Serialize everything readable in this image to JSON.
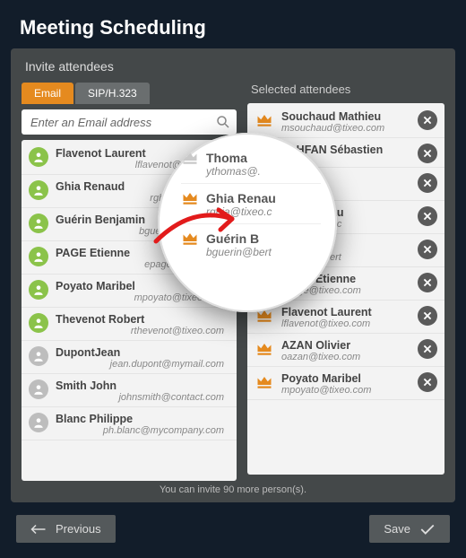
{
  "title": "Meeting Scheduling",
  "panelTitle": "Invite attendees",
  "tabs": {
    "email": "Email",
    "sip": "SIP/H.323"
  },
  "search": {
    "placeholder": "Enter an Email address"
  },
  "selectedTitle": "Selected attendees",
  "note": "You can invite 90 more person(s).",
  "footer": {
    "prev": "Previous",
    "save": "Save"
  },
  "contacts": [
    {
      "name": "Flavenot Laurent",
      "email": "lflavenot@tixeo.com",
      "status": "green"
    },
    {
      "name": "Ghia Renaud",
      "email": "rghia@tixeo.com",
      "status": "green"
    },
    {
      "name": "Guérin Benjamin",
      "email": "bguerin@tixeo.com",
      "status": "green"
    },
    {
      "name": "PAGE Etienne",
      "email": "epage@tixeo.com",
      "status": "green"
    },
    {
      "name": "Poyato Maribel",
      "email": "mpoyato@tixeo.com",
      "status": "green"
    },
    {
      "name": "Thevenot Robert",
      "email": "rthevenot@tixeo.com",
      "status": "green"
    },
    {
      "name": "DupontJean",
      "email": "jean.dupont@mymail.com",
      "status": "gray"
    },
    {
      "name": "Smith John",
      "email": "johnsmith@contact.com",
      "status": "gray"
    },
    {
      "name": "Blanc Philippe",
      "email": "ph.blanc@mycompany.com",
      "status": "gray"
    }
  ],
  "selected": [
    {
      "name": "Souchaud Mathieu",
      "email": "msouchaud@tixeo.com"
    },
    {
      "name": "LAHFAN Sébastien",
      "email": ""
    },
    {
      "name": "Thomas",
      "email": "ythomas@"
    },
    {
      "name": "Ghia Renau",
      "email": "rghia@tixeo.c"
    },
    {
      "name": "Guérin B",
      "email": "bguerin@bert"
    },
    {
      "name": "PAGE Etienne",
      "email": "epage@tixeo.com"
    },
    {
      "name": "Flavenot Laurent",
      "email": "lflavenot@tixeo.com"
    },
    {
      "name": "AZAN Olivier",
      "email": "oazan@tixeo.com"
    },
    {
      "name": "Poyato Maribel",
      "email": "mpoyato@tixeo.com"
    }
  ],
  "magnifier": [
    {
      "name": "Thoma",
      "email": "ythomas@.",
      "crown": "gray"
    },
    {
      "name": "Ghia Renau",
      "email": "rghia@tixeo.c",
      "crown": "orange"
    },
    {
      "name": "Guérin B",
      "email": "bguerin@bert",
      "crown": "orange"
    }
  ]
}
